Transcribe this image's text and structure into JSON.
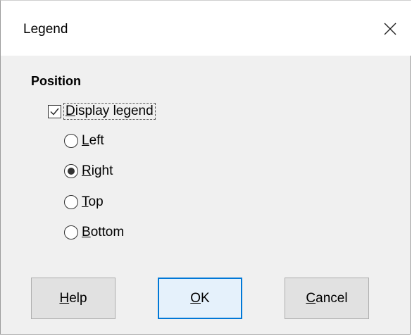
{
  "window": {
    "title": "Legend"
  },
  "position_group": {
    "title": "Position",
    "display_legend": {
      "label": "Display legend",
      "mnemonic": "D",
      "rest": "isplay legend",
      "checked": true
    },
    "options": [
      {
        "label": "Left",
        "mnemonic": "L",
        "rest": "eft",
        "selected": false
      },
      {
        "label": "Right",
        "mnemonic": "R",
        "rest": "ight",
        "selected": true
      },
      {
        "label": "Top",
        "mnemonic": "T",
        "rest": "op",
        "selected": false
      },
      {
        "label": "Bottom",
        "mnemonic": "B",
        "rest": "ottom",
        "selected": false
      }
    ]
  },
  "buttons": {
    "help": {
      "mnemonic": "H",
      "rest": "elp"
    },
    "ok": {
      "mnemonic": "O",
      "rest": "K"
    },
    "cancel": {
      "mnemonic": "C",
      "rest": "ancel"
    }
  },
  "colors": {
    "dialog_bg": "#f0f0f0",
    "default_button_border": "#0078d7"
  },
  "icons": [
    "close-icon",
    "checkmark-icon"
  ]
}
